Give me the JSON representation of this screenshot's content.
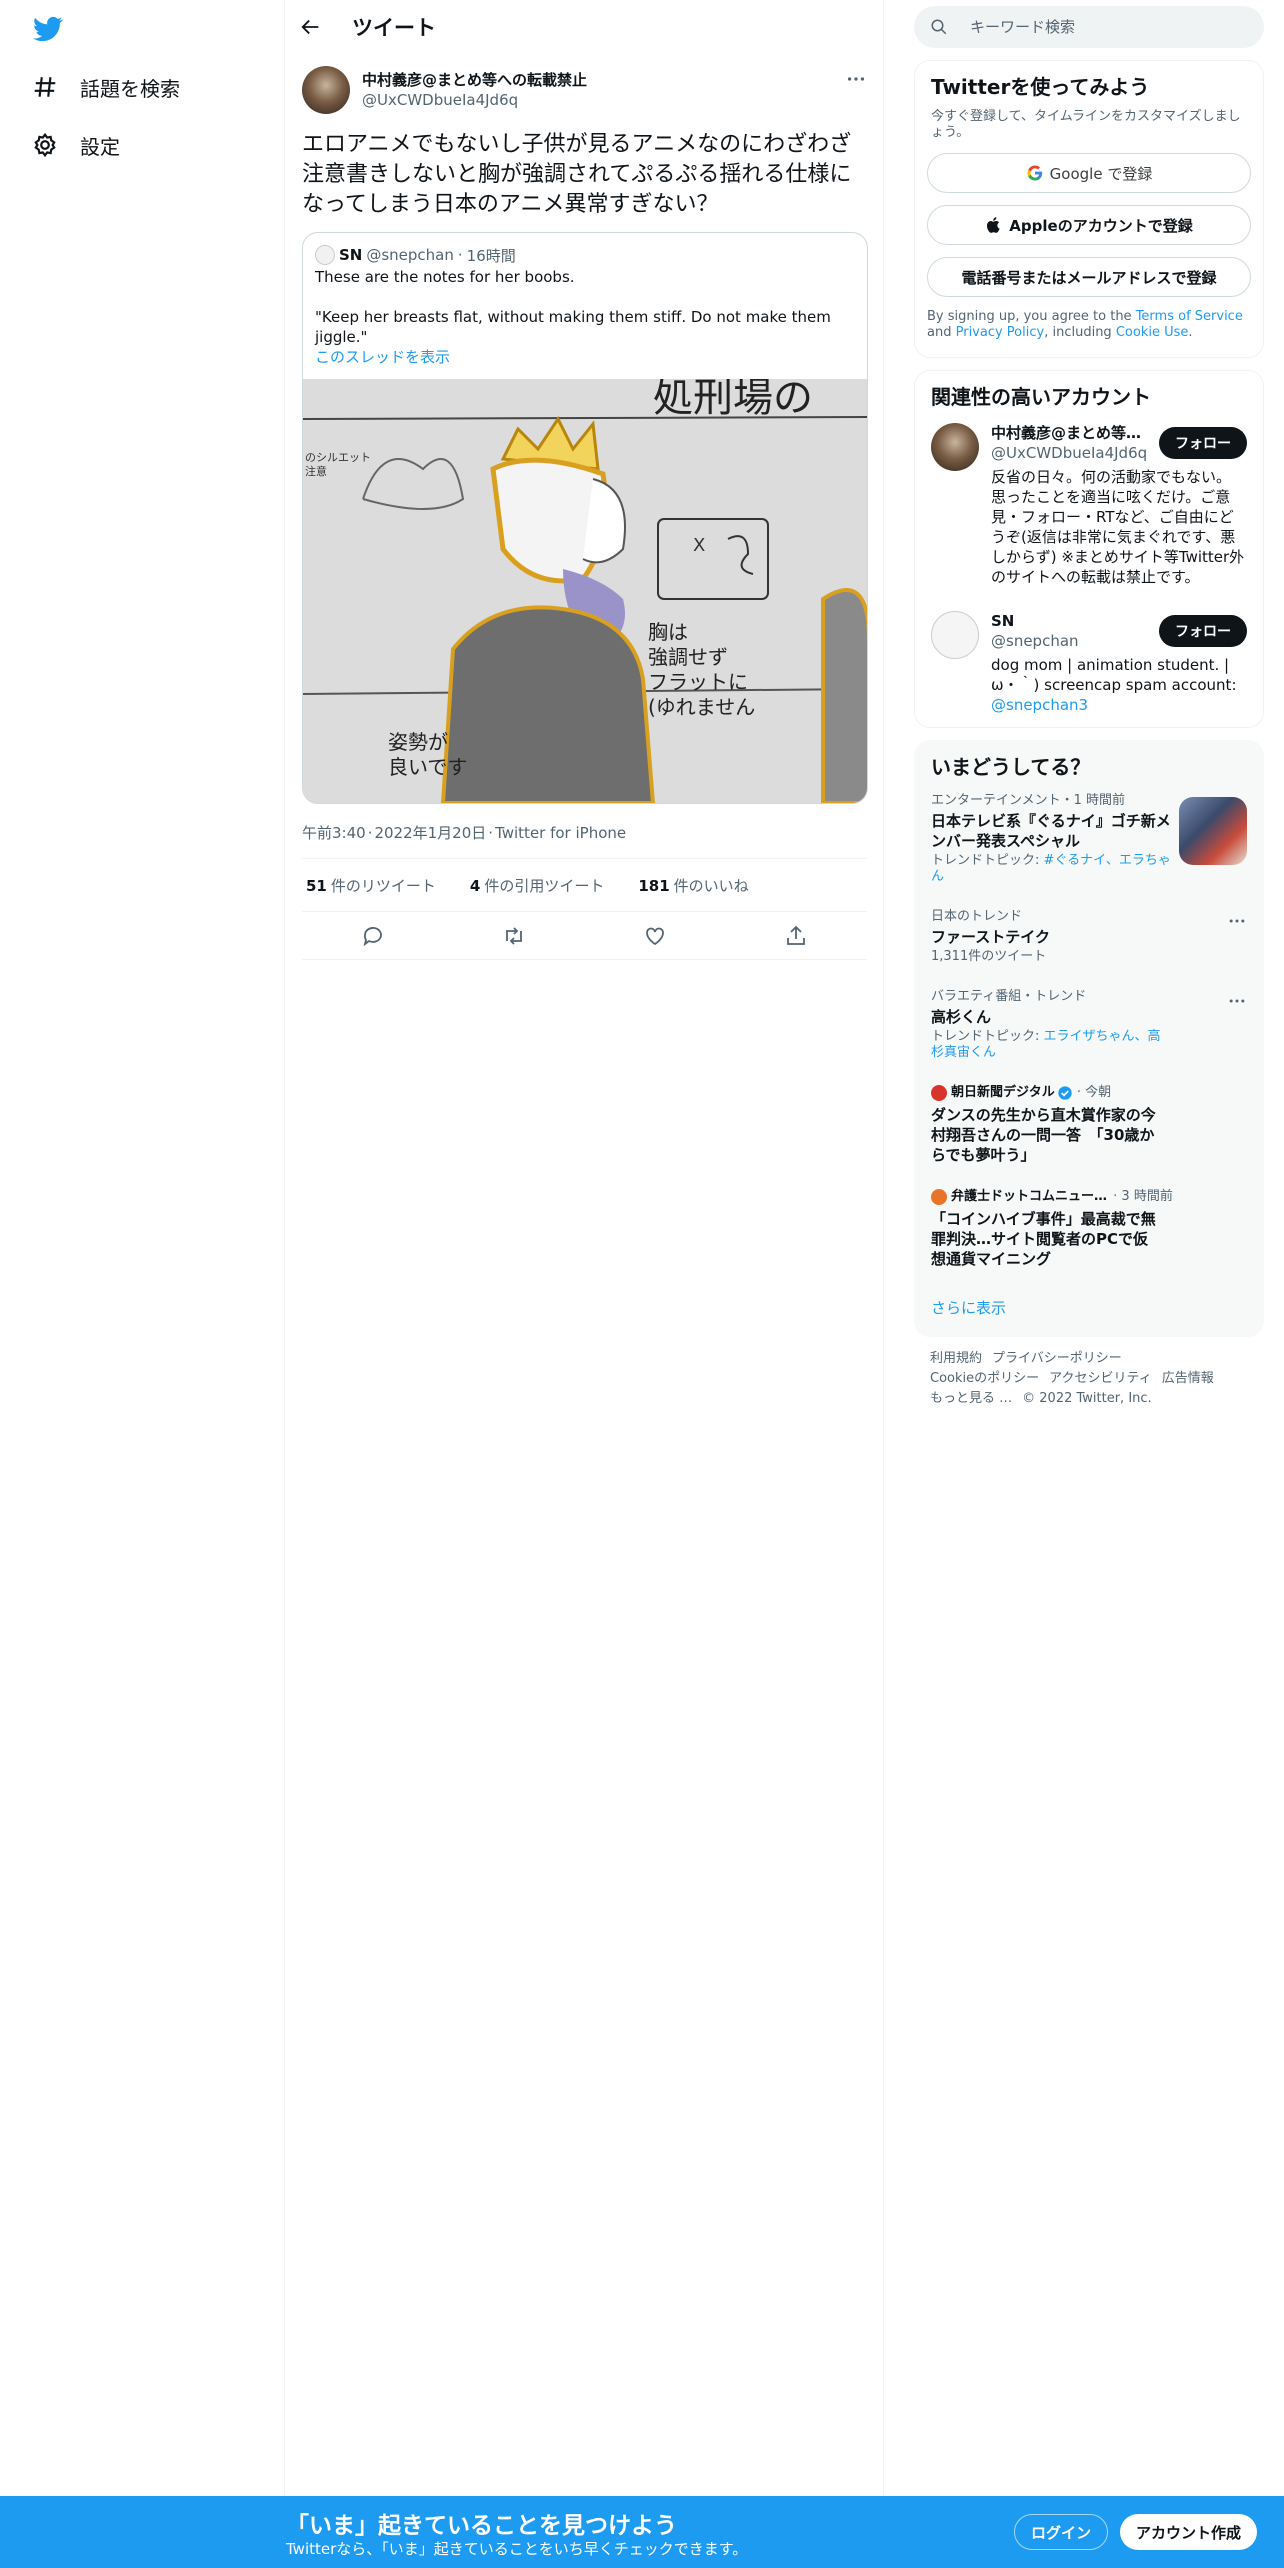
{
  "nav": {
    "items": [
      {
        "label": "話題を検索",
        "icon": "hashtag-icon"
      },
      {
        "label": "設定",
        "icon": "gear-icon"
      }
    ]
  },
  "header": {
    "title": "ツイート"
  },
  "tweet": {
    "display_name": "中村義彦@まとめ等への転載禁止",
    "handle": "@UxCWDbueIa4Jd6q",
    "text": "エロアニメでもないし子供が見るアニメなのにわざわざ注意書きしないと胸が強調されてぷるぷる揺れる仕様になってしまう日本のアニメ異常すぎない？",
    "quote": {
      "display_name": "SN",
      "handle": "@snepchan",
      "time": "16時間",
      "text1": "These are the notes for her boobs.",
      "text2": "\"Keep her breasts flat, without making them stiff. Do not make them jiggle.\"",
      "thread_link": "このスレッドを表示",
      "image_text": {
        "top": "処刑場の",
        "silhouette": "のシルエット\n注意",
        "chest_note": "胸は\n強調せず\nフラットに\n(ゆれません",
        "posture_note": "姿勢が\n良いです"
      }
    },
    "time": "午前3:40",
    "date": "2022年1月20日",
    "client": "Twitter for iPhone",
    "stats": {
      "retweets": "51",
      "retweets_label": "件のリツイート",
      "quotes": "4",
      "quotes_label": "件の引用ツイート",
      "likes": "181",
      "likes_label": "件のいいね"
    }
  },
  "search": {
    "placeholder": "キーワード検索"
  },
  "signup": {
    "title": "Twitterを使ってみよう",
    "desc": "今すぐ登録して、タイムラインをカスタマイズしましょう。",
    "google": "Google で登録",
    "apple": "Appleのアカウントで登録",
    "phone": "電話番号またはメールアドレスで登録",
    "terms_pre": "By signing up, you agree to the",
    "terms_link": "Terms of Service",
    "terms_and": "and",
    "privacy_link": "Privacy Policy",
    "terms_inc": ", including",
    "cookie_link": "Cookie Use",
    "terms_end": "."
  },
  "relevant": {
    "title": "関連性の高いアカウント",
    "follow_label": "フォロー",
    "accounts": [
      {
        "display_name": "中村義彦@まとめ等…",
        "handle": "@UxCWDbueIa4Jd6q",
        "bio": "反省の日々。何の活動家でもない。思ったことを適当に呟くだけ。ご意見・フォロー・RTなど、ご自由にどうぞ(返信は非常に気まぐれです、悪しからず) ※まとめサイト等Twitter外のサイトへの転載は禁止です。"
      },
      {
        "display_name": "SN",
        "handle": "@snepchan",
        "bio": "dog mom | animation student. |ω・｀) screencap spam account:",
        "bio_link": "@snepchan3"
      }
    ]
  },
  "trends": {
    "title": "いまどうしてる？",
    "items": [
      {
        "cat": "エンターテインメント・1 時間前",
        "title": "日本テレビ系『ぐるナイ』ゴチ新メンバー発表スペシャル",
        "sub_pre": "トレンドトピック: ",
        "sub_links": "#ぐるナイ、エラちゃん"
      },
      {
        "cat": "日本のトレンド",
        "title": "ファーストテイク",
        "sub": "1,311件のツイート"
      },
      {
        "cat": "バラエティ番組・トレンド",
        "title": "高杉くん",
        "sub_pre": "トレンドトピック: ",
        "sub_links": "エライザちゃん、高杉真宙くん"
      },
      {
        "source": "朝日新聞デジタル",
        "time": "今朝",
        "title": "ダンスの先生から直木賞作家の今村翔吾さんの一問一答　「30歳からでも夢叶う」",
        "color": "#d9342b"
      },
      {
        "source": "弁護士ドットコムニュー…",
        "time": "3 時間前",
        "title": "「コインハイブ事件」最高裁で無罪判決…サイト閲覧者のPCで仮想通貨マイニング",
        "color": "#e8742a"
      }
    ],
    "show_more": "さらに表示"
  },
  "footer": {
    "items": [
      "利用規約",
      "プライバシーポリシー",
      "Cookieのポリシー",
      "アクセシビリティ",
      "広告情報",
      "もっと見る …",
      "© 2022 Twitter, Inc."
    ]
  },
  "banner": {
    "headline": "「いま」起きていることを見つけよう",
    "sub": "Twitterなら、「いま」起きていることをいち早くチェックできます。",
    "login": "ログイン",
    "signup": "アカウント作成"
  },
  "colors": {
    "accent": "#1d9bf0",
    "text": "#0f1419",
    "muted": "#536471"
  }
}
